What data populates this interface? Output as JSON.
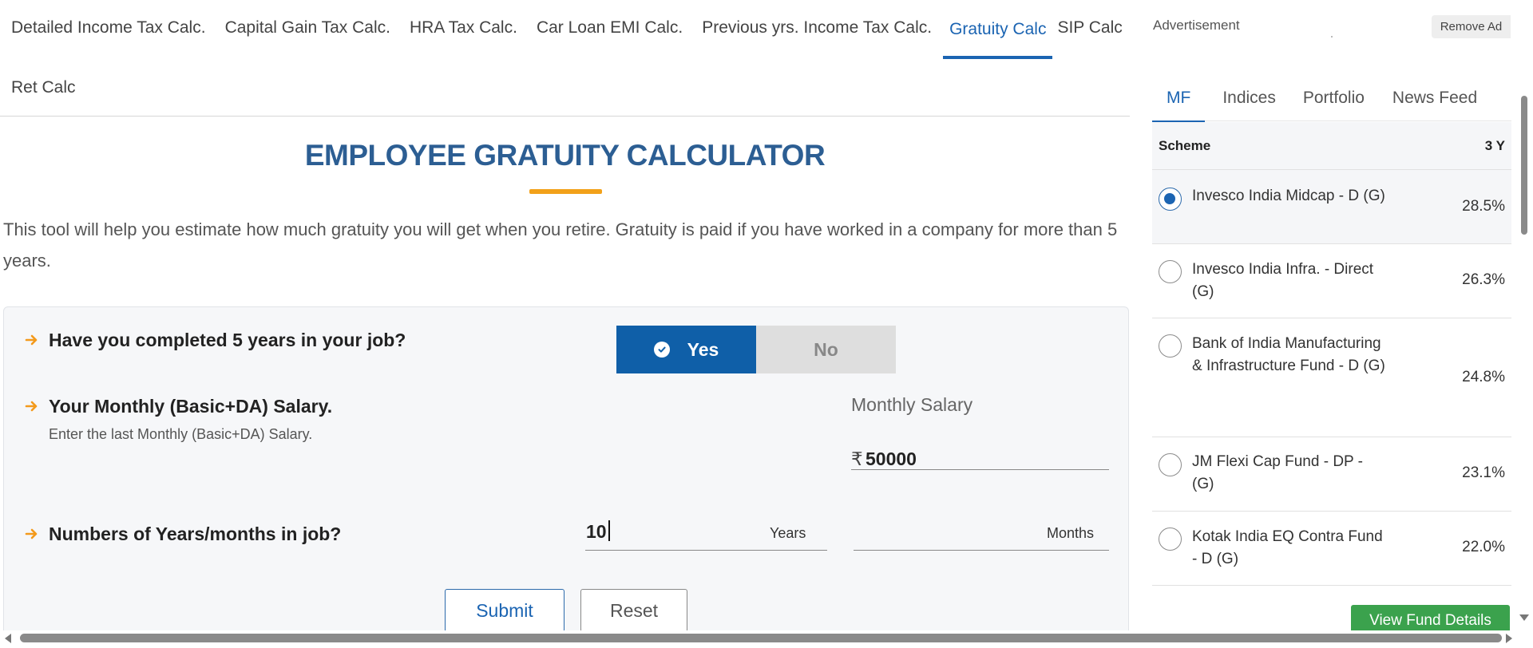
{
  "calc_nav": {
    "tabs": [
      {
        "label": "Detailed Income Tax Calc."
      },
      {
        "label": "Capital Gain Tax Calc."
      },
      {
        "label": "HRA Tax Calc."
      },
      {
        "label": "Car Loan EMI Calc."
      },
      {
        "label": "Previous yrs. Income Tax Calc."
      },
      {
        "label": "Gratuity Calc"
      },
      {
        "label": "SIP Calc"
      },
      {
        "label": "Ret Calc"
      }
    ],
    "active": "Gratuity Calc"
  },
  "page": {
    "title": "EMPLOYEE GRATUITY CALCULATOR",
    "intro": "This tool will help you estimate how much gratuity you will get when you retire. Gratuity is paid if you have worked in a company for more than 5 years."
  },
  "form": {
    "q1": {
      "label": "Have you completed 5 years in your job?",
      "yes_label": "Yes",
      "no_label": "No",
      "selected": "Yes"
    },
    "q2": {
      "label": "Your Monthly (Basic+DA) Salary.",
      "sublabel": "Enter the last Monthly (Basic+DA) Salary.",
      "field_caption": "Monthly Salary",
      "currency_symbol": "₹",
      "value": "50000"
    },
    "q3": {
      "label": "Numbers of Years/months in job?",
      "years_value": "10",
      "years_unit": "Years",
      "months_value": "",
      "months_unit": "Months"
    },
    "submit_label": "Submit",
    "reset_label": "Reset"
  },
  "sidebar": {
    "ad_label": "Advertisement",
    "remove_ad_label": "Remove Ad",
    "tabs": [
      {
        "label": "MF"
      },
      {
        "label": "Indices"
      },
      {
        "label": "Portfolio"
      },
      {
        "label": "News Feed"
      }
    ],
    "active_tab": "MF",
    "table": {
      "col_scheme": "Scheme",
      "col_period": "3 Y",
      "rows": [
        {
          "name": "Invesco India Midcap - D (G)",
          "return": "28.5%",
          "selected": true
        },
        {
          "name": "Invesco India Infra. - Direct (G)",
          "return": "26.3%",
          "selected": false
        },
        {
          "name": "Bank of India Manufacturing & Infrastructure Fund - D (G)",
          "return": "24.8%",
          "selected": false
        },
        {
          "name": "JM Flexi Cap Fund - DP - (G)",
          "return": "23.1%",
          "selected": false
        },
        {
          "name": "Kotak India EQ Contra Fund - D (G)",
          "return": "22.0%",
          "selected": false
        }
      ]
    },
    "view_button_label": "View Fund Details"
  },
  "colors": {
    "primary_blue": "#1b64b2",
    "title_blue": "#2c5e93",
    "accent_orange": "#f2a11a",
    "yes_button_blue": "#0f5fa8",
    "view_button_green": "#3ba24d"
  },
  "icons": {
    "question_bullet": "arrow-right-icon",
    "yes_check": "check-circle-icon"
  }
}
